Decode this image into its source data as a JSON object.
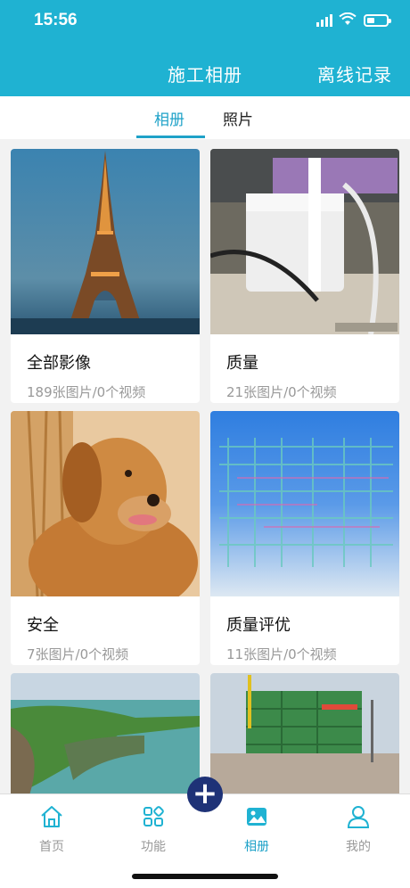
{
  "status_bar": {
    "time": "15:56"
  },
  "nav": {
    "title": "施工相册",
    "right_action": "离线记录"
  },
  "tabs": [
    {
      "label": "相册",
      "active": true
    },
    {
      "label": "照片",
      "active": false
    }
  ],
  "albums": [
    {
      "title": "全部影像",
      "subtitle": "189张图片/0个视频"
    },
    {
      "title": "质量",
      "subtitle": "21张图片/0个视频"
    },
    {
      "title": "安全",
      "subtitle": "7张图片/0个视频"
    },
    {
      "title": "质量评优",
      "subtitle": "11张图片/0个视频"
    }
  ],
  "tabbar": [
    {
      "label": "首页",
      "icon": "home-icon"
    },
    {
      "label": "功能",
      "icon": "grid-icon"
    },
    {
      "label": "相册",
      "icon": "image-icon",
      "active": true
    },
    {
      "label": "我的",
      "icon": "user-icon"
    }
  ],
  "colors": {
    "accent": "#1fb2d2",
    "fab": "#1e3277"
  },
  "battery_level": 0.4
}
